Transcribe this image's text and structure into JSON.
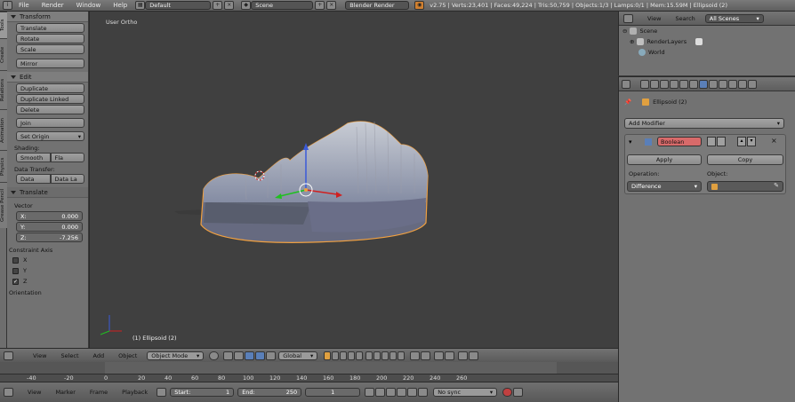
{
  "top_bar": {
    "menus": [
      "File",
      "Render",
      "Window",
      "Help"
    ],
    "screen_layout": "Default",
    "scene": "Scene",
    "render_engine": "Blender Render",
    "stats": "v2.75 | Verts:23,401 | Faces:49,224 | Tris:50,759 | Objects:1/3 | Lamps:0/1 | Mem:15.59M | Ellipsoid (2)"
  },
  "tool_tabs": [
    "Tools",
    "Create",
    "Relations",
    "Animation",
    "Physics",
    "Grease Pencil"
  ],
  "tool_shelf": {
    "transform_header": "Transform",
    "transform_buttons": [
      "Translate",
      "Rotate",
      "Scale"
    ],
    "mirror": "Mirror",
    "edit_header": "Edit",
    "edit_buttons": [
      "Duplicate",
      "Duplicate Linked",
      "Delete"
    ],
    "join": "Join",
    "set_origin": "Set Origin",
    "shading_label": "Shading:",
    "shading_buttons": [
      "Smooth",
      "Fla"
    ],
    "data_transfer_label": "Data Transfer:",
    "data_transfer_buttons": [
      "Data",
      "Data La"
    ],
    "translate_header": "Translate",
    "vector_label": "Vector",
    "vector": [
      {
        "axis": "X:",
        "value": "0.000"
      },
      {
        "axis": "Y:",
        "value": "0.000"
      },
      {
        "axis": "Z:",
        "value": "-7.256"
      }
    ],
    "constraint_label": "Constraint Axis",
    "constraint_axes": [
      {
        "axis": "X",
        "checked": false
      },
      {
        "axis": "Y",
        "checked": false
      },
      {
        "axis": "Z",
        "checked": true
      }
    ],
    "orientation_label": "Orientation"
  },
  "viewport": {
    "view_label": "User Ortho",
    "object_label": "(1) Ellipsoid (2)"
  },
  "view3d_header": {
    "menus": [
      "View",
      "Select",
      "Add",
      "Object"
    ],
    "mode": "Object Mode",
    "orientation": "Global"
  },
  "timeline": {
    "ticks": [
      "-40",
      "-20",
      "0",
      "20",
      "40",
      "60",
      "80",
      "100",
      "120",
      "140",
      "160",
      "180",
      "200",
      "220",
      "240",
      "260"
    ],
    "menus": [
      "View",
      "Marker",
      "Frame",
      "Playback"
    ],
    "start_label": "Start:",
    "start_value": "1",
    "end_label": "End:",
    "end_value": "250",
    "current_frame": "1",
    "sync": "No sync"
  },
  "outliner": {
    "menus": [
      "View",
      "Search"
    ],
    "filter": "All Scenes",
    "items": [
      "Scene",
      "RenderLayers",
      "World"
    ]
  },
  "properties": {
    "object_name": "Ellipsoid (2)",
    "add_modifier": "Add Modifier",
    "modifier_name": "Boolean",
    "apply": "Apply",
    "copy": "Copy",
    "operation_label": "Operation:",
    "operation_value": "Difference",
    "object_label": "Object:"
  },
  "colors": {
    "accent_blue": "#5a7fb8",
    "modifier_name_bg": "#d86a6a",
    "selection_orange": "#f0a040"
  }
}
